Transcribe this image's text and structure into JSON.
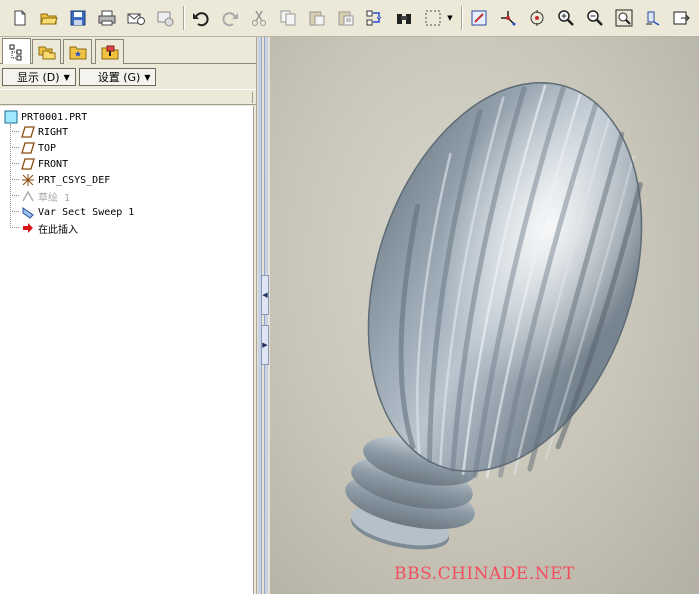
{
  "toolbar": {
    "icons": [
      "new-file-icon",
      "open-folder-icon",
      "save-icon",
      "print-icon",
      "send-mail-icon",
      "close-window-icon",
      "undo-icon",
      "redo-icon",
      "cut-icon",
      "copy-icon",
      "paste-icon",
      "paste-special-icon",
      "regenerate-icon",
      "find-binoculars-icon",
      "select-box-icon",
      "repaint-icon",
      "spin-center-icon",
      "orient-mode-icon",
      "zoom-in-icon",
      "zoom-out-icon",
      "refit-icon",
      "reorient-icon",
      "saved-views-icon"
    ]
  },
  "left_panel": {
    "tabs": [
      "model-tree-tab",
      "folder-browser-tab",
      "favorites-tab",
      "connections-tab"
    ],
    "menus": {
      "show_label": "显示 (D)",
      "settings_label": "设置 (G)"
    },
    "tree": {
      "root": "PRT0001.PRT",
      "items": [
        {
          "label": "RIGHT",
          "icon": "datum-plane-icon"
        },
        {
          "label": "TOP",
          "icon": "datum-plane-icon"
        },
        {
          "label": "FRONT",
          "icon": "datum-plane-icon"
        },
        {
          "label": "PRT_CSYS_DEF",
          "icon": "coordinate-system-icon"
        },
        {
          "label": "草绘 1",
          "icon": "sketch-icon"
        },
        {
          "label": "Var Sect Sweep 1",
          "icon": "sweep-feature-icon"
        },
        {
          "label": "在此插入",
          "icon": "insert-here-arrow-icon"
        }
      ]
    }
  },
  "viewport": {
    "watermark": "BBS.CHINADE.NET"
  },
  "colors": {
    "toolbar_bg": "#ece9d8",
    "viewport_bg": "#c8c5b8",
    "model_color": "#8e9ba6",
    "watermark": "#f24e5e"
  }
}
